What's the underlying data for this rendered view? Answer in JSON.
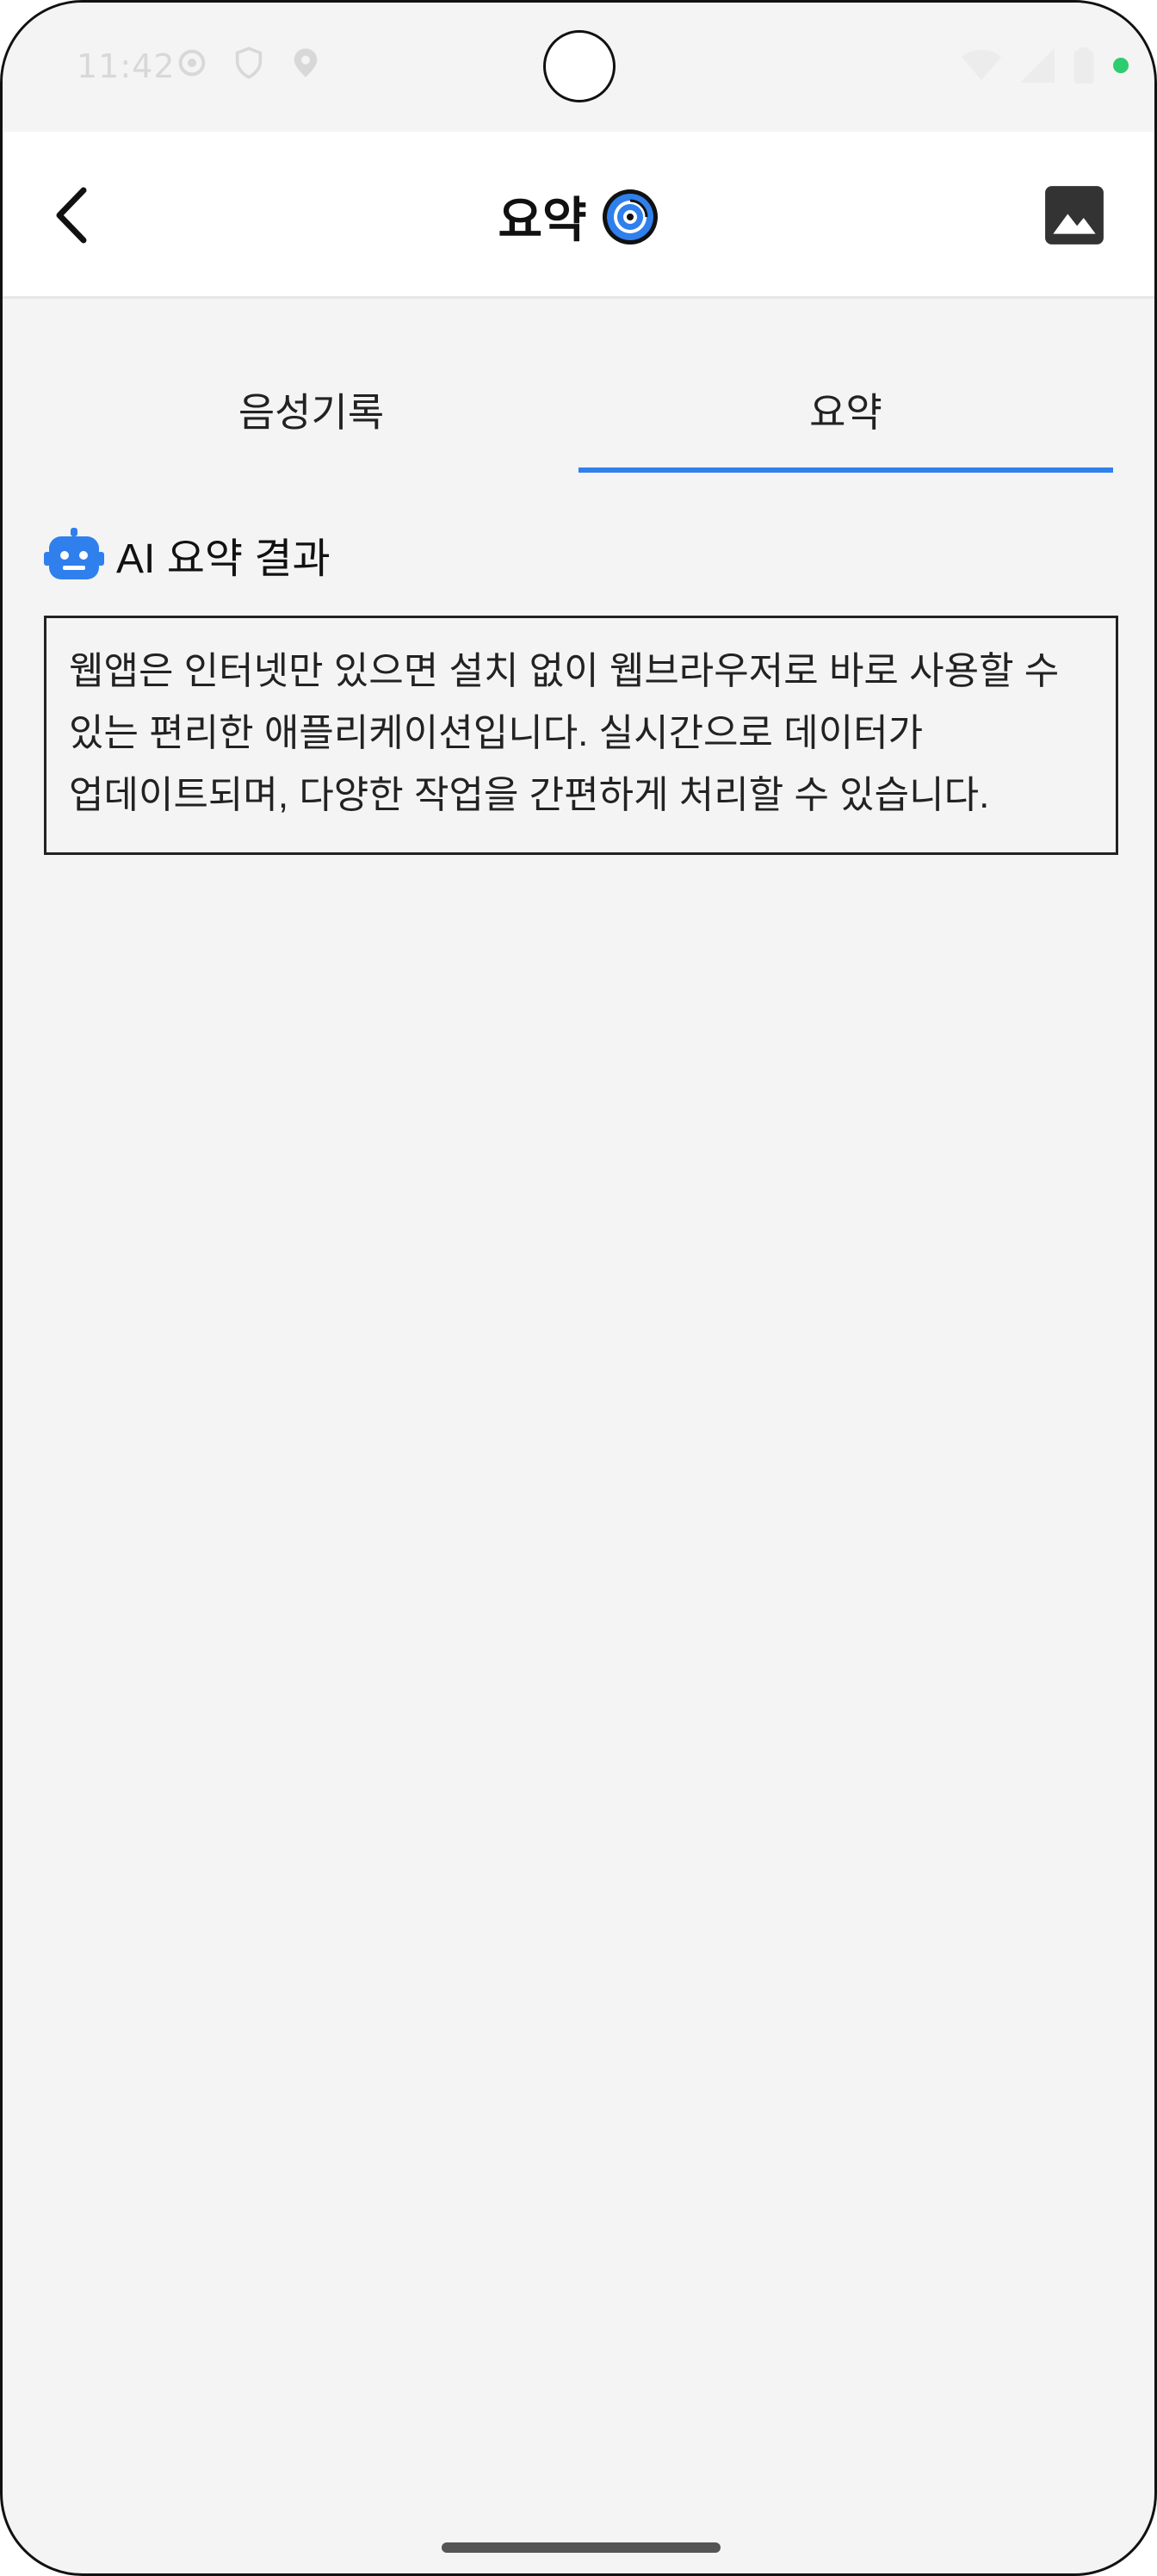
{
  "status_bar": {
    "time": "11:42",
    "left_icons": [
      "settings-icon",
      "shield-icon",
      "location-icon"
    ],
    "right_icons": [
      "wifi-icon",
      "signal-icon",
      "battery-icon"
    ],
    "indicator_color": "#2ecc71"
  },
  "app_bar": {
    "back_icon": "chevron-left-icon",
    "title": "요약",
    "title_logo": "app-logo-icon",
    "image_icon": "image-icon"
  },
  "tabs": [
    {
      "label": "음성기록",
      "active": false
    },
    {
      "label": "요약",
      "active": true
    }
  ],
  "section": {
    "icon": "robot-icon",
    "title": "AI 요약 결과"
  },
  "summary": {
    "text": "웹앱은 인터넷만 있으면 설치 없이 웹브라우저로 바로 사용할 수 있는 편리한 애플리케이션입니다. 실시간으로 데이터가 업데이트되며, 다양한 작업을 간편하게 처리할 수 있습니다."
  },
  "colors": {
    "accent": "#2f80ed",
    "background": "#f4f4f4",
    "app_bar": "#ffffff",
    "text": "#111111"
  }
}
